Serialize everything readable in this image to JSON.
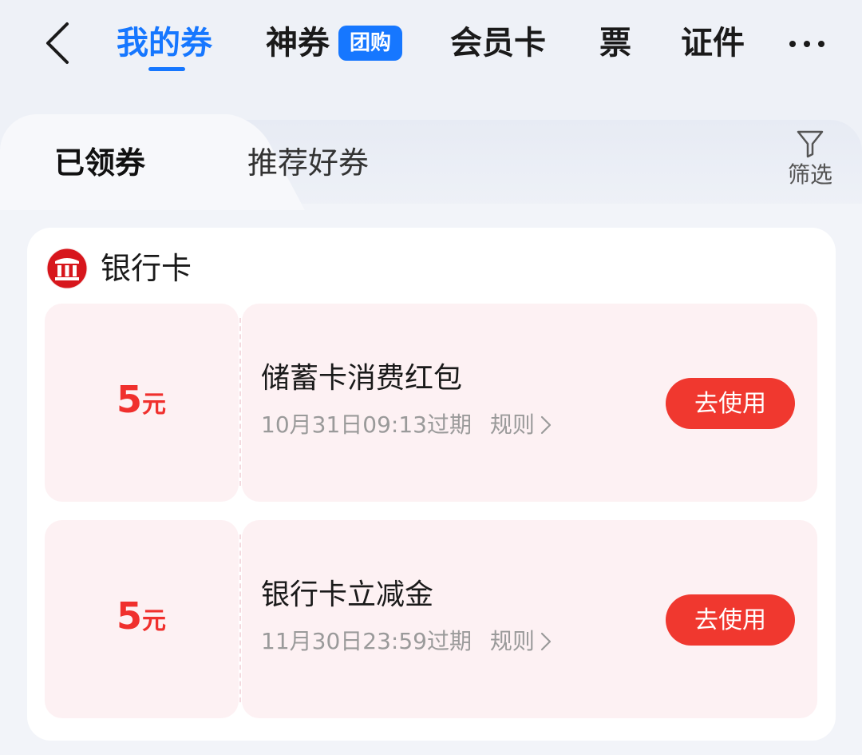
{
  "nav": {
    "tabs": [
      {
        "label": "我的券"
      },
      {
        "label": "神券"
      },
      {
        "label": "会员卡"
      },
      {
        "label": "票"
      },
      {
        "label": "证件"
      }
    ],
    "badge": "团购",
    "active_color": "#1677ff"
  },
  "subtabs": {
    "items": [
      {
        "label": "已领券"
      },
      {
        "label": "推荐好券"
      }
    ],
    "filter_label": "筛选"
  },
  "section": {
    "title": "银行卡",
    "icon": "bank-icon",
    "coupons": [
      {
        "amount": "5",
        "unit": "元",
        "title": "储蓄卡消费红包",
        "expiry": "10月31日09:13过期",
        "rules_label": "规则",
        "button_label": "去使用"
      },
      {
        "amount": "5",
        "unit": "元",
        "title": "银行卡立减金",
        "expiry": "11月30日23:59过期",
        "rules_label": "规则",
        "button_label": "去使用"
      }
    ]
  },
  "colors": {
    "accent": "#1677ff",
    "coupon_red": "#f0302d",
    "coupon_bg": "#fdf1f3"
  }
}
